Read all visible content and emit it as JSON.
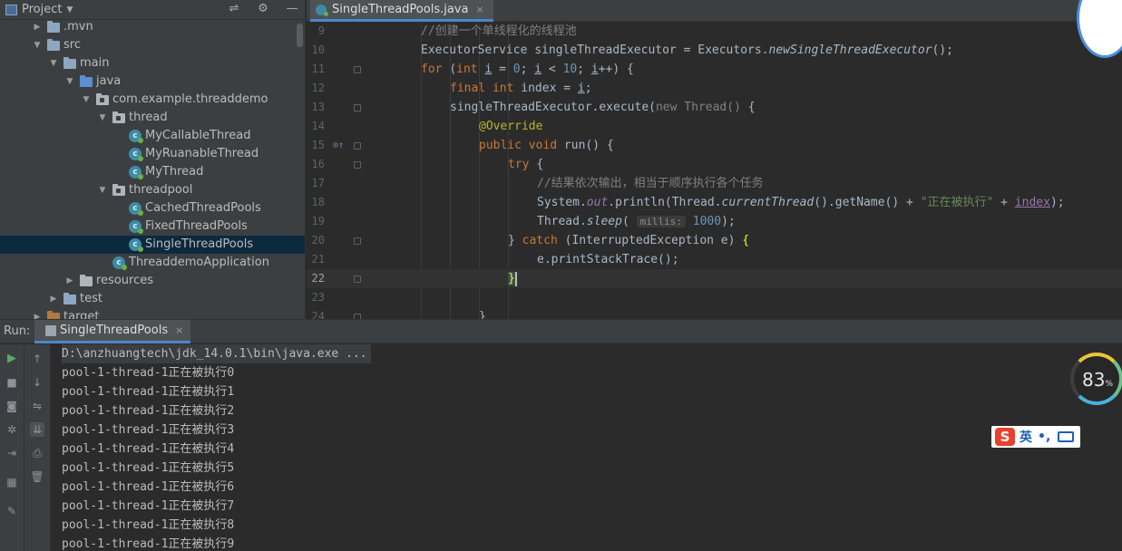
{
  "project_panel": {
    "title": "Project",
    "tools": [
      "⇌",
      "⚙",
      "—"
    ],
    "tree": [
      {
        "label": ".mvn",
        "depth": 1,
        "arrow": "▶",
        "icon": "folder"
      },
      {
        "label": "src",
        "depth": 1,
        "arrow": "▼",
        "icon": "folder"
      },
      {
        "label": "main",
        "depth": 2,
        "arrow": "▼",
        "icon": "folder"
      },
      {
        "label": "java",
        "depth": 3,
        "arrow": "▼",
        "icon": "folder-blue"
      },
      {
        "label": "com.example.threaddemo",
        "depth": 4,
        "arrow": "▼",
        "icon": "package"
      },
      {
        "label": "thread",
        "depth": 5,
        "arrow": "▼",
        "icon": "package"
      },
      {
        "label": "MyCallableThread",
        "depth": 6,
        "arrow": "",
        "icon": "class"
      },
      {
        "label": "MyRuanableThread",
        "depth": 6,
        "arrow": "",
        "icon": "class"
      },
      {
        "label": "MyThread",
        "depth": 6,
        "arrow": "",
        "icon": "class"
      },
      {
        "label": "threadpool",
        "depth": 5,
        "arrow": "▼",
        "icon": "package"
      },
      {
        "label": "CachedThreadPools",
        "depth": 6,
        "arrow": "",
        "icon": "class"
      },
      {
        "label": "FixedThreadPools",
        "depth": 6,
        "arrow": "",
        "icon": "class"
      },
      {
        "label": "SingleThreadPools",
        "depth": 6,
        "arrow": "",
        "icon": "class",
        "selected": true
      },
      {
        "label": "ThreaddemoApplication",
        "depth": 5,
        "arrow": "",
        "icon": "class"
      },
      {
        "label": "resources",
        "depth": 3,
        "arrow": "▶",
        "icon": "folder-gray"
      },
      {
        "label": "test",
        "depth": 2,
        "arrow": "▶",
        "icon": "folder"
      },
      {
        "label": "target",
        "depth": 1,
        "arrow": "▶",
        "icon": "folder-orange"
      }
    ]
  },
  "editor": {
    "tab_title": "SingleThreadPools.java",
    "tab_close": "×",
    "lines": [
      {
        "n": "9",
        "segs": [
          {
            "t": "//创建一个单线程化的线程池",
            "c": "cmt"
          }
        ]
      },
      {
        "n": "10",
        "segs": [
          {
            "t": "ExecutorService singleThreadExecutor = Executors."
          },
          {
            "t": "newSingleThreadExecutor",
            "c": "stat"
          },
          {
            "t": "();"
          }
        ]
      },
      {
        "n": "11",
        "segs": [
          {
            "t": "for ",
            "c": "kw"
          },
          {
            "t": "("
          },
          {
            "t": "int ",
            "c": "kw"
          },
          {
            "t": "i",
            "c": "var"
          },
          {
            "t": " = "
          },
          {
            "t": "0",
            "c": "num"
          },
          {
            "t": "; "
          },
          {
            "t": "i",
            "c": "var"
          },
          {
            "t": " < "
          },
          {
            "t": "10",
            "c": "num"
          },
          {
            "t": "; "
          },
          {
            "t": "i",
            "c": "var"
          },
          {
            "t": "++) {"
          }
        ]
      },
      {
        "n": "12",
        "segs": [
          {
            "t": "final int ",
            "c": "kw"
          },
          {
            "t": "index = "
          },
          {
            "t": "i",
            "c": "var"
          },
          {
            "t": ";"
          }
        ]
      },
      {
        "n": "13",
        "segs": [
          {
            "t": "singleThreadExecutor.execute("
          },
          {
            "t": "new ",
            "c": "gray"
          },
          {
            "t": "Thread() ",
            "c": "gray"
          },
          {
            "t": "{"
          }
        ]
      },
      {
        "n": "14",
        "segs": [
          {
            "t": "@Override",
            "c": "ann"
          }
        ]
      },
      {
        "n": "15",
        "segs": [
          {
            "t": "public void ",
            "c": "kw"
          },
          {
            "t": "run() {"
          }
        ]
      },
      {
        "n": "16",
        "segs": [
          {
            "t": "try ",
            "c": "kw"
          },
          {
            "t": "{"
          }
        ]
      },
      {
        "n": "17",
        "segs": [
          {
            "t": "//结果依次输出，相当于顺序执行各个任务",
            "c": "cmt"
          }
        ]
      },
      {
        "n": "18",
        "segs": [
          {
            "t": "System."
          },
          {
            "t": "out",
            "c": "fld"
          },
          {
            "t": ".println(Thread."
          },
          {
            "t": "currentThread",
            "c": "stat"
          },
          {
            "t": "().getName() + "
          },
          {
            "t": "\"正在被执行\"",
            "c": "str"
          },
          {
            "t": " + "
          },
          {
            "t": "index",
            "c": "lvar"
          },
          {
            "t": ");"
          }
        ]
      },
      {
        "n": "19",
        "segs": [
          {
            "t": "Thread."
          },
          {
            "t": "sleep",
            "c": "stat"
          },
          {
            "t": "( "
          },
          {
            "t": "millis:",
            "c": "hint"
          },
          {
            "t": " "
          },
          {
            "t": "1000",
            "c": "num"
          },
          {
            "t": ");"
          }
        ]
      },
      {
        "n": "20",
        "segs": [
          {
            "t": "} "
          },
          {
            "t": "catch ",
            "c": "kw"
          },
          {
            "t": "(InterruptedException e) "
          },
          {
            "t": "{",
            "c": "yellow"
          }
        ]
      },
      {
        "n": "21",
        "segs": [
          {
            "t": "e.printStackTrace();"
          }
        ]
      },
      {
        "n": "22",
        "segs": [
          {
            "t": "}",
            "c": "brace-hl"
          }
        ]
      },
      {
        "n": "23",
        "segs": []
      },
      {
        "n": "24",
        "segs": [
          {
            "t": "}"
          }
        ]
      }
    ]
  },
  "run_panel": {
    "label": "Run:",
    "tab_title": "SingleThreadPools",
    "tab_close": "×",
    "command": "D:\\anzhuangtech\\jdk_14.0.1\\bin\\java.exe ...",
    "output": [
      "pool-1-thread-1正在被执行0",
      "pool-1-thread-1正在被执行1",
      "pool-1-thread-1正在被执行2",
      "pool-1-thread-1正在被执行3",
      "pool-1-thread-1正在被执行4",
      "pool-1-thread-1正在被执行5",
      "pool-1-thread-1正在被执行6",
      "pool-1-thread-1正在被执行7",
      "pool-1-thread-1正在被执行8",
      "pool-1-thread-1正在被执行9"
    ]
  },
  "overlays": {
    "cpu_value": "83",
    "cpu_unit": "%",
    "ime_logo": "S",
    "ime_lang": "英",
    "ime_punct": "•,"
  }
}
